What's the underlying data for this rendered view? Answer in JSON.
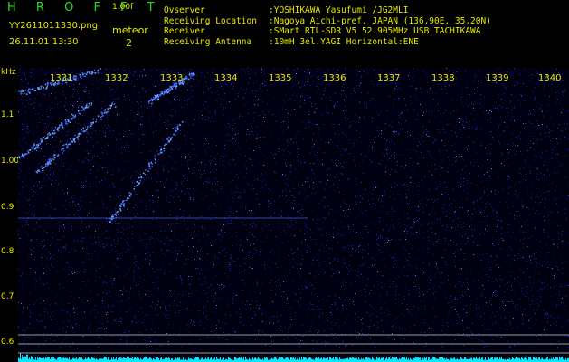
{
  "header": {
    "app_title": "HROFFT",
    "version": "1.00f",
    "filename": "YY2611011330.png",
    "datetime": "26.11.01 13:30",
    "meteor_label": "meteor",
    "meteor_count": "2"
  },
  "station": [
    {
      "key": "Ovserver",
      "value": ":YOSHIKAWA Yasufumi /JG2MLI"
    },
    {
      "key": "Receiving Location",
      "value": ":Nagoya Aichi-pref. JAPAN (136.90E, 35.20N)"
    },
    {
      "key": "Receiver",
      "value": ":SMart RTL-SDR V5 52.905MHz USB TACHIKAWA"
    },
    {
      "key": "Receiving Antenna",
      "value": ":10mH 3el.YAGI Horizontal:ENE"
    }
  ],
  "y_axis": {
    "unit": "kHz",
    "labels": [
      "1.1",
      "1.00",
      "0.9",
      "0.8",
      "0.7",
      "0.6"
    ]
  },
  "time_ticks": [
    "1331",
    "1332",
    "1333",
    "1334",
    "1335",
    "1336",
    "1337",
    "1338",
    "1339",
    "1340"
  ],
  "colors": {
    "background": "#000000",
    "text": "#e8e800",
    "title": "#20e020",
    "noise": "#2030d0",
    "echo": "#6aa8ff",
    "baseline": "#00e8ff"
  }
}
